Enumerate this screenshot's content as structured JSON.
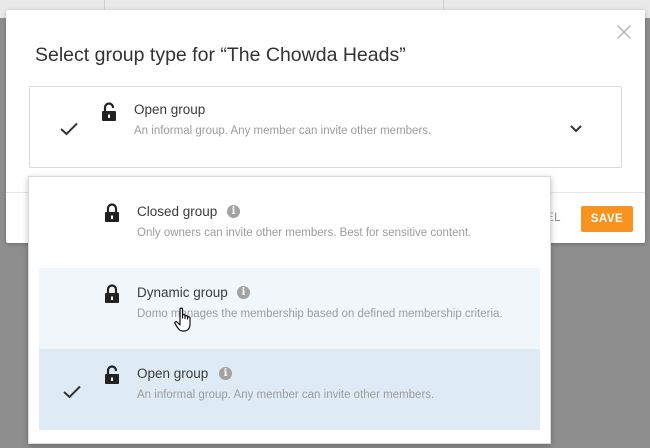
{
  "dialog": {
    "title": "Select group type for “The Chowda Heads”",
    "close_icon": "close-icon",
    "selected": {
      "title": "Open group",
      "description": "An informal group. Any member can invite other members.",
      "lock_icon": "unlocked-padlock-icon",
      "check_icon": "checkmark-icon",
      "chevron_icon": "chevron-down-icon"
    },
    "cancel_label": "EL",
    "save_label": "SAVE"
  },
  "dropdown": {
    "options": [
      {
        "title": "Closed group",
        "description": "Only owners can invite other members. Best for sensitive content.",
        "icon": "locked-padlock-icon",
        "state": "normal"
      },
      {
        "title": "Dynamic group",
        "description": "Domo manages the membership based on defined membership criteria.",
        "icon": "locked-padlock-icon",
        "state": "hover"
      },
      {
        "title": "Open group",
        "description": "An informal group. Any member can invite other members.",
        "icon": "unlocked-padlock-icon",
        "state": "selected"
      }
    ]
  },
  "colors": {
    "accent": "#f7931e",
    "hover_bg": "#f1f6fb",
    "selected_bg": "#deebf4",
    "overlay": "#8e8e8e"
  }
}
